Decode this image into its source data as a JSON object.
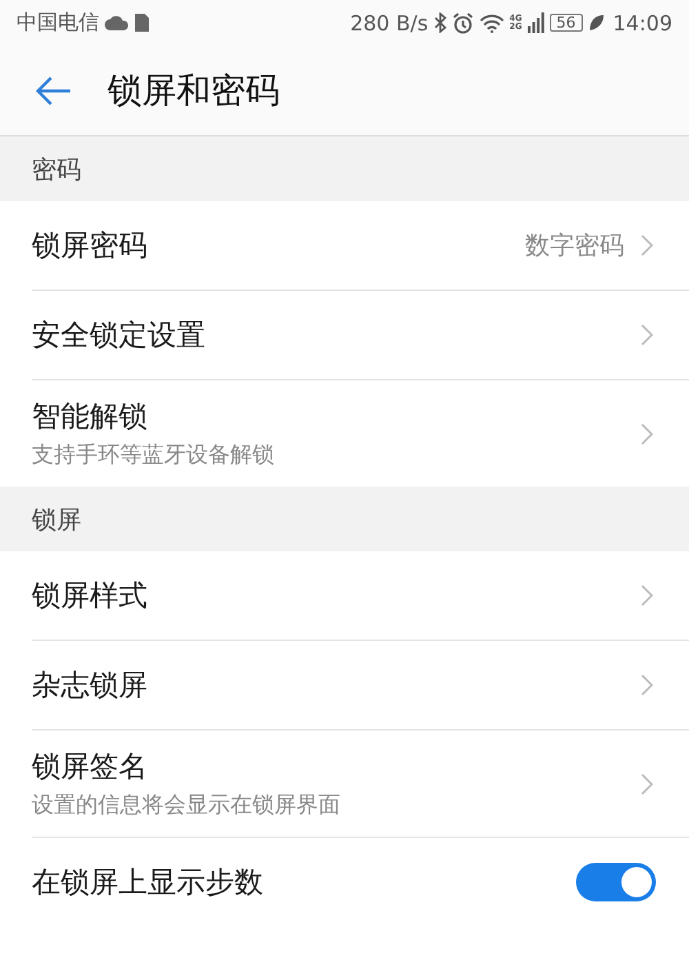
{
  "status_bar": {
    "carrier": "中国电信",
    "speed": "280 B/s",
    "network_top": "4G",
    "network_bottom": "2G",
    "battery": "56",
    "time": "14:09"
  },
  "header": {
    "title": "锁屏和密码"
  },
  "sections": [
    {
      "title": "密码",
      "items": [
        {
          "kind": "nav",
          "label": "锁屏密码",
          "value": "数字密码"
        },
        {
          "kind": "nav",
          "label": "安全锁定设置"
        },
        {
          "kind": "nav",
          "label": "智能解锁",
          "subtitle": "支持手环等蓝牙设备解锁"
        }
      ]
    },
    {
      "title": "锁屏",
      "items": [
        {
          "kind": "nav",
          "label": "锁屏样式"
        },
        {
          "kind": "nav",
          "label": "杂志锁屏"
        },
        {
          "kind": "nav",
          "label": "锁屏签名",
          "subtitle": "设置的信息将会显示在锁屏界面"
        },
        {
          "kind": "toggle",
          "label": "在锁屏上显示步数",
          "on": true
        }
      ]
    }
  ]
}
